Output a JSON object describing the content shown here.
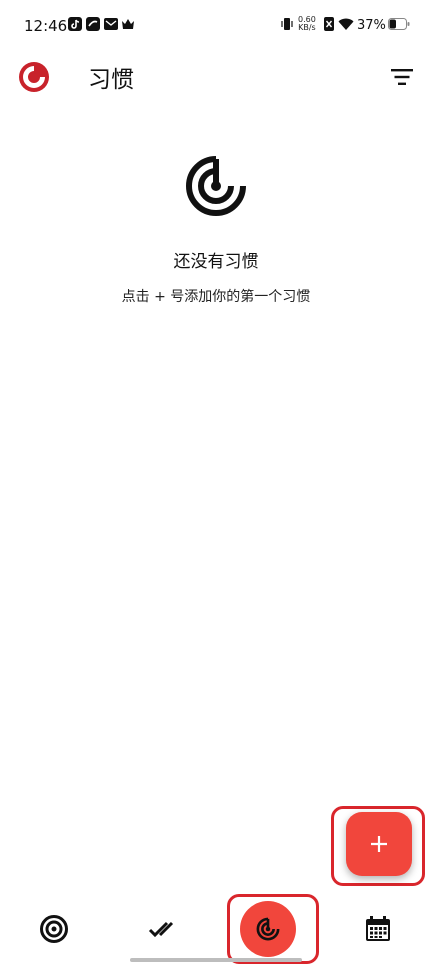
{
  "status_bar": {
    "time": "12:46",
    "net_speed_value": "0.60",
    "net_speed_unit": "KB/s",
    "battery_percent": "37%"
  },
  "app_bar": {
    "title": "习惯",
    "logo_icon": "app-logo-icon",
    "filter_icon": "filter-icon"
  },
  "empty_state": {
    "icon": "habit-target-icon",
    "title": "还没有习惯",
    "subtitle": "点击 + 号添加你的第一个习惯"
  },
  "fab": {
    "icon": "plus-icon"
  },
  "bottom_nav": {
    "items": [
      {
        "icon": "target-icon",
        "active": false
      },
      {
        "icon": "double-check-icon",
        "active": false
      },
      {
        "icon": "habit-radar-icon",
        "active": true
      },
      {
        "icon": "calendar-icon",
        "active": false
      }
    ]
  },
  "colors": {
    "accent": "#f1463c",
    "logo_red": "#c8232b",
    "highlight_outline": "#d9262c"
  }
}
